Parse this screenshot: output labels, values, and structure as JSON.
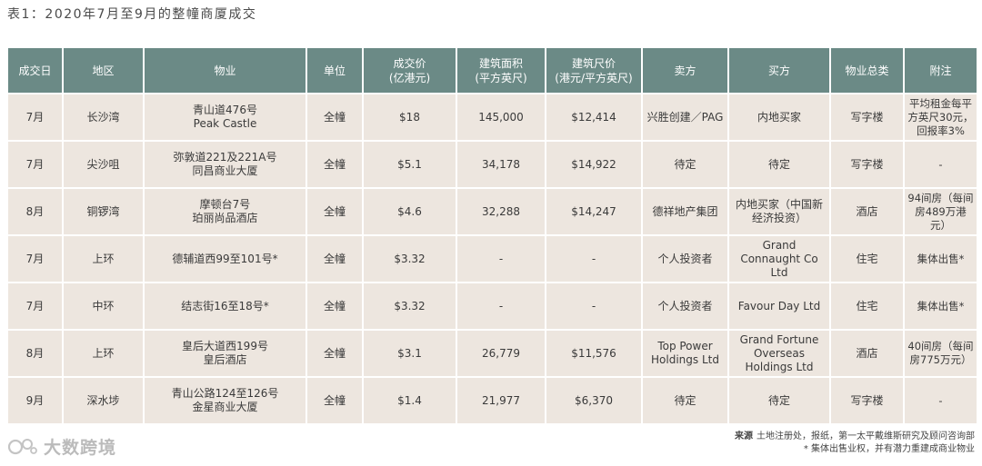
{
  "caption": "表1：2020年7月至9月的整幢商厦成交",
  "table": {
    "headers": [
      "成交日",
      "地区",
      "物业",
      "单位",
      "成交价\n(亿港元)",
      "建筑面积\n(平方英尺)",
      "建筑尺价\n(港元/平方英尺)",
      "卖方",
      "买方",
      "物业总类",
      "附注"
    ],
    "rows": [
      [
        "7月",
        "长沙湾",
        "青山道476号\nPeak Castle",
        "全幢",
        "$18",
        "145,000",
        "$12,414",
        "兴胜创建／PAG",
        "内地买家",
        "写字楼",
        "平均租金每平方英尺30元，回报率3%"
      ],
      [
        "7月",
        "尖沙咀",
        "弥敦道221及221A号\n同昌商业大厦",
        "全幢",
        "$5.1",
        "34,178",
        "$14,922",
        "待定",
        "待定",
        "写字楼",
        "-"
      ],
      [
        "8月",
        "铜锣湾",
        "摩顿台7号\n珀丽尚品酒店",
        "全幢",
        "$4.6",
        "32,288",
        "$14,247",
        "德祥地产集团",
        "内地买家（中国新经济投资）",
        "酒店",
        "94间房（每间房489万港元）"
      ],
      [
        "7月",
        "上环",
        "德辅道西99至101号*",
        "全幢",
        "$3.32",
        "-",
        "-",
        "个人投资者",
        "Grand\nConnaught Co\nLtd",
        "住宅",
        "集体出售*"
      ],
      [
        "7月",
        "中环",
        "结志街16至18号*",
        "全幢",
        "$3.32",
        "-",
        "-",
        "个人投资者",
        "Favour Day Ltd",
        "住宅",
        "集体出售*"
      ],
      [
        "8月",
        "上环",
        "皇后大道西199号\n皇后酒店",
        "全幢",
        "$3.1",
        "26,779",
        "$11,576",
        "Top Power\nHoldings Ltd",
        "Grand Fortune\nOverseas\nHoldings Ltd",
        "酒店",
        "40间房（每间房775万元）"
      ],
      [
        "9月",
        "深水埗",
        "青山公路124至126号\n金星商业大厦",
        "全幢",
        "$1.4",
        "21,977",
        "$6,370",
        "待定",
        "待定",
        "写字楼",
        "-"
      ]
    ]
  },
  "source": {
    "label": "来源",
    "text": "土地注册处，报纸，第一太平戴维斯研究及顾问咨询部",
    "footnote": "* 集体出售业权，并有潜力重建成商业物业"
  },
  "watermark": {
    "text": "大数跨境",
    "icon": "brand-logo-icon"
  },
  "colors": {
    "header_bg": "#6b8a86",
    "cell_bg": "#ede6df"
  }
}
